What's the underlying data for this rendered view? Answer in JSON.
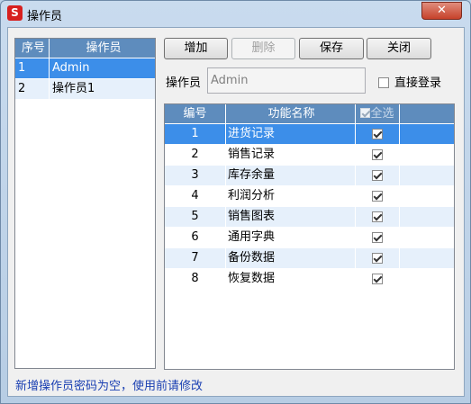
{
  "window": {
    "title": "操作员",
    "app_icon_letter": "S",
    "close_glyph": "✕"
  },
  "operator_list": {
    "headers": [
      "序号",
      "操作员"
    ],
    "rows": [
      {
        "no": "1",
        "name": "Admin",
        "selected": true
      },
      {
        "no": "2",
        "name": "操作员1",
        "selected": false
      }
    ]
  },
  "toolbar": {
    "add_label": "增加",
    "delete_label": "删除",
    "save_label": "保存",
    "close_label": "关闭"
  },
  "operator_field": {
    "label": "操作员",
    "value": "Admin"
  },
  "direct_login": {
    "label": "直接登录",
    "checked": false
  },
  "function_grid": {
    "headers": {
      "no": "编号",
      "name": "功能名称",
      "select_all": "全选"
    },
    "select_all_checked": true,
    "rows": [
      {
        "no": "1",
        "name": "进货记录",
        "checked": true
      },
      {
        "no": "2",
        "name": "销售记录",
        "checked": true
      },
      {
        "no": "3",
        "name": "库存余量",
        "checked": true
      },
      {
        "no": "4",
        "name": "利润分析",
        "checked": true
      },
      {
        "no": "5",
        "name": "销售图表",
        "checked": true
      },
      {
        "no": "6",
        "name": "通用字典",
        "checked": true
      },
      {
        "no": "7",
        "name": "备份数据",
        "checked": true
      },
      {
        "no": "8",
        "name": "恢复数据",
        "checked": true
      }
    ]
  },
  "status": {
    "message": "新增操作员密码为空，使用前请修改"
  },
  "colors": {
    "header_blue": "#5e8cbd",
    "selection_blue": "#3c8ee9",
    "alt_row": "#e6f0fb",
    "status_text": "#1a3fb2",
    "close_red": "#c7412a"
  }
}
